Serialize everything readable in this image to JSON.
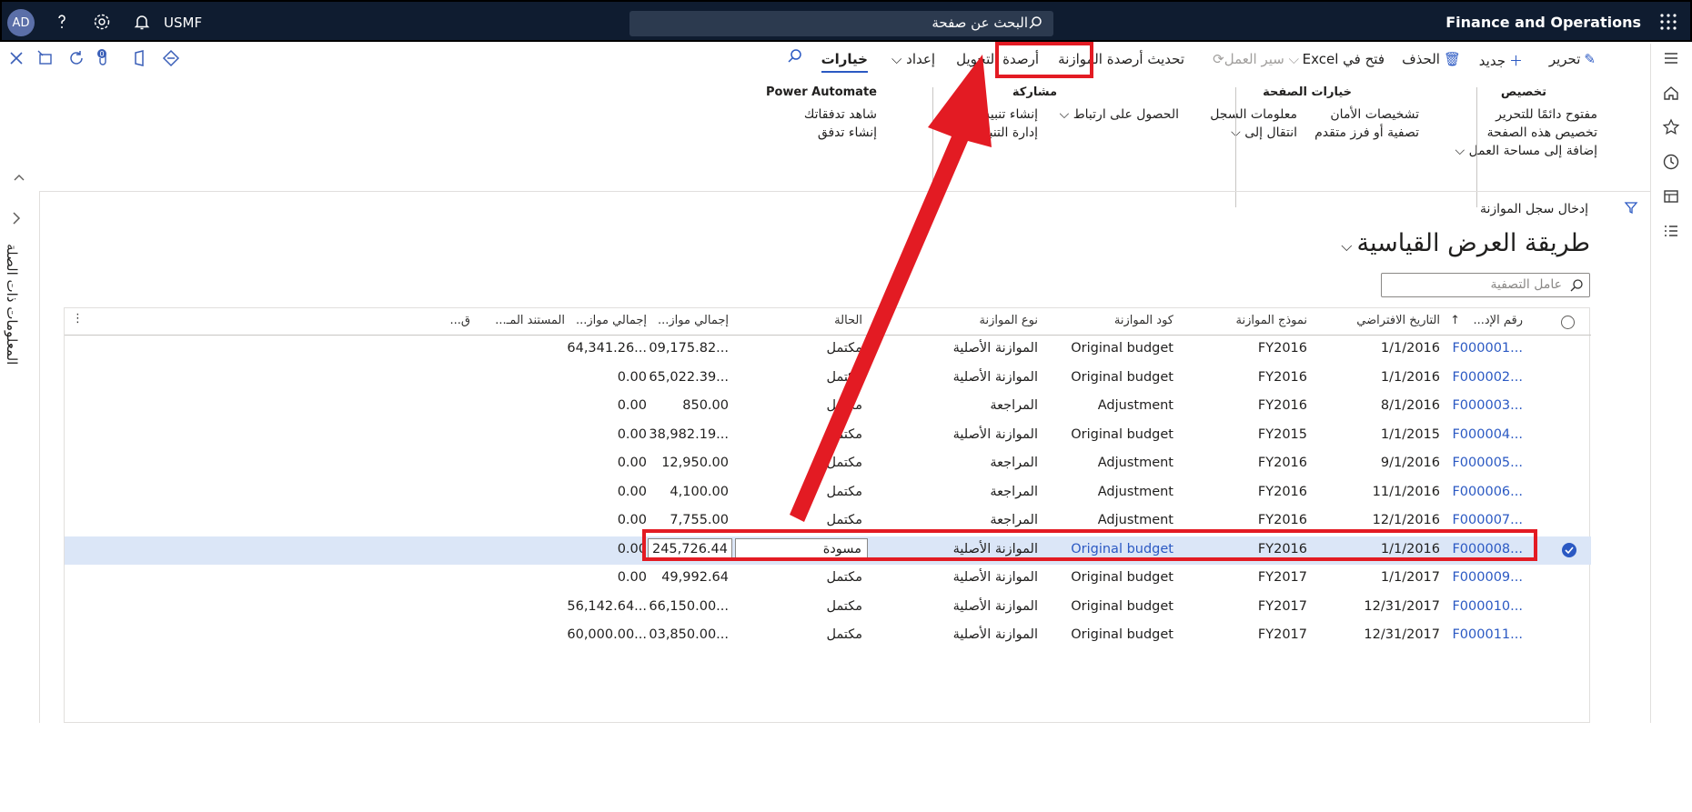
{
  "topbar": {
    "avatar": "AD",
    "company": "USMF",
    "search_placeholder": "البحث عن صفحة",
    "app_name": "Finance and Operations"
  },
  "actionpane": {
    "tabs": {
      "edit": "تحرير",
      "new": "جديد",
      "delete": "الحذف",
      "excel": "فتح في Excel",
      "workflow": "سير العمل",
      "update_balances": "تحديث أرصدة الموازنة",
      "transfer_balances": "أرصدة التحويل",
      "setup": "إعداد",
      "options": "خيارات"
    },
    "groups": {
      "personalize": {
        "title": "تخصيص",
        "items": [
          "مفتوح دائمًا للتحرير",
          "تخصيص هذه الصفحة",
          "إضافة إلى مساحة العمل"
        ]
      },
      "page_options": {
        "title": "خيارات الصفحة",
        "col1": [
          "تشخيصات الأمان",
          "تصفية أو فرز متقدم"
        ],
        "col2": [
          "معلومات السجل",
          "انتقال إلى"
        ]
      },
      "share": {
        "title": "مشاركة",
        "col1": [
          "الحصول على ارتباط"
        ],
        "col2": [
          "إنشاء تنبيه مخ",
          "إدارة التنبيهات"
        ]
      },
      "power_automate": {
        "title": "Power Automate",
        "items": [
          "شاهد تدفقاتك",
          "إنشاء تدفق"
        ]
      }
    }
  },
  "factbox": {
    "label": "المعلومات ذات الصلة"
  },
  "page": {
    "breadcrumb": "إدخال سجل الموازنة",
    "title": "طريقة العرض القياسية",
    "filter_placeholder": "عامل التصفية"
  },
  "grid": {
    "headers": {
      "number": "رقم الإد...",
      "default_date": "التاريخ الافتراضي",
      "model": "نموذج الموازنة",
      "code": "كود الموازنة",
      "type": "نوع الموازنة",
      "status": "الحالة",
      "total1": "إجمالي مواز...",
      "total2": "إجمالي مواز...",
      "document": "المستند المـ...",
      "q": "ق..."
    },
    "rows": [
      {
        "number": "F000001...",
        "date": "1/1/2016",
        "model": "FY2016",
        "code": "Original budget",
        "type": "الموازنة الأصلية",
        "status": "مكتمل",
        "total1": "09,175.82...",
        "total2": "64,341.26..."
      },
      {
        "number": "F000002...",
        "date": "1/1/2016",
        "model": "FY2016",
        "code": "Original budget",
        "type": "الموازنة الأصلية",
        "status": "مكتمل",
        "total1": "65,022.39...",
        "total2": "0.00"
      },
      {
        "number": "F000003...",
        "date": "8/1/2016",
        "model": "FY2016",
        "code": "Adjustment",
        "type": "المراجعة",
        "status": "مكتمل",
        "total1": "850.00",
        "total2": "0.00"
      },
      {
        "number": "F000004...",
        "date": "1/1/2015",
        "model": "FY2015",
        "code": "Original budget",
        "type": "الموازنة الأصلية",
        "status": "مكتمل",
        "total1": "38,982.19...",
        "total2": "0.00"
      },
      {
        "number": "F000005...",
        "date": "9/1/2016",
        "model": "FY2016",
        "code": "Adjustment",
        "type": "المراجعة",
        "status": "مكتمل",
        "total1": "12,950.00",
        "total2": "0.00"
      },
      {
        "number": "F000006...",
        "date": "11/1/2016",
        "model": "FY2016",
        "code": "Adjustment",
        "type": "المراجعة",
        "status": "مكتمل",
        "total1": "4,100.00",
        "total2": "0.00"
      },
      {
        "number": "F000007...",
        "date": "12/1/2016",
        "model": "FY2016",
        "code": "Adjustment",
        "type": "المراجعة",
        "status": "مكتمل",
        "total1": "7,755.00",
        "total2": "0.00"
      },
      {
        "number": "F000008...",
        "date": "1/1/2016",
        "model": "FY2016",
        "code": "Original budget",
        "type": "الموازنة الأصلية",
        "status": "مسودة",
        "total1": "245,726.44",
        "total2": "0.00"
      },
      {
        "number": "F000009...",
        "date": "1/1/2017",
        "model": "FY2017",
        "code": "Original budget",
        "type": "الموازنة الأصلية",
        "status": "مكتمل",
        "total1": "49,992.64",
        "total2": "0.00"
      },
      {
        "number": "F000010...",
        "date": "12/31/2017",
        "model": "FY2017",
        "code": "Original budget",
        "type": "الموازنة الأصلية",
        "status": "مكتمل",
        "total1": "66,150.00...",
        "total2": "56,142.64..."
      },
      {
        "number": "F000011...",
        "date": "12/31/2017",
        "model": "FY2017",
        "code": "Original budget",
        "type": "الموازنة الأصلية",
        "status": "مكتمل",
        "total1": "03,850.00...",
        "total2": "60,000.00..."
      }
    ]
  },
  "colors": {
    "highlight": "#e31b23",
    "link": "#2b59c3",
    "selected_row": "#dbe6f7"
  }
}
